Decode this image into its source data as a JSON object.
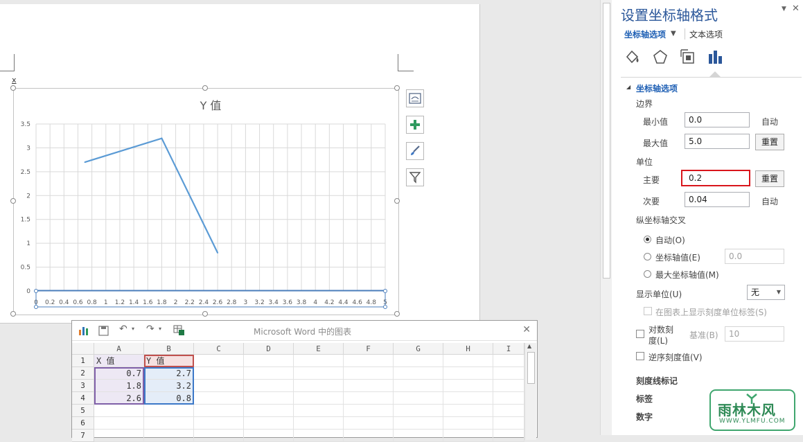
{
  "document": {
    "cursor_mark": "x"
  },
  "chart": {
    "side_buttons": [
      "chart-layout-icon",
      "plus-icon",
      "brush-icon",
      "filter-icon"
    ]
  },
  "chart_data": {
    "type": "scatter",
    "title": "Y 值",
    "mode": "line",
    "x": [
      0.7,
      1.8,
      2.6
    ],
    "y": [
      2.7,
      3.2,
      0.8
    ],
    "xlim": [
      0,
      5
    ],
    "ylim": [
      0,
      3.5
    ],
    "x_ticks": [
      "0",
      "0.2",
      "0.4",
      "0.6",
      "0.8",
      "1",
      "1.2",
      "1.4",
      "1.6",
      "1.8",
      "2",
      "2.2",
      "2.4",
      "2.6",
      "2.8",
      "3",
      "3.2",
      "3.4",
      "3.6",
      "3.8",
      "4",
      "4.2",
      "4.4",
      "4.6",
      "4.8",
      "5"
    ],
    "y_ticks": [
      "0",
      "0.5",
      "1",
      "1.5",
      "2",
      "2.5",
      "3",
      "3.5"
    ],
    "grid": true,
    "line_color": "#5b9bd5"
  },
  "sheet": {
    "title": "Microsoft Word 中的图表",
    "close": "✕",
    "columns": [
      "A",
      "B",
      "C",
      "D",
      "E",
      "F",
      "G",
      "H",
      "I"
    ],
    "rows": [
      "1",
      "2",
      "3",
      "4",
      "5",
      "6",
      "7"
    ],
    "cells": [
      [
        "X 值",
        "Y 值"
      ],
      [
        "0.7",
        "2.7"
      ],
      [
        "1.8",
        "3.2"
      ],
      [
        "2.6",
        "0.8"
      ]
    ],
    "range_colors": {
      "x": "#7f5fa8",
      "y": "#3b78c8",
      "header": "#c0504d"
    }
  },
  "panel": {
    "title": "设置坐标轴格式",
    "header_icons": [
      "▼",
      "✕"
    ],
    "tab_axis": "坐标轴选项",
    "tab_text": "文本选项",
    "section": "坐标轴选项",
    "bounds": "边界",
    "min_label": "最小值",
    "min_value": "0.0",
    "min_auto": "自动",
    "max_label": "最大值",
    "max_value": "5.0",
    "max_reset": "重置",
    "units": "单位",
    "major_label": "主要",
    "major_value": "0.2",
    "major_reset": "重置",
    "minor_label": "次要",
    "minor_value": "0.04",
    "minor_auto": "自动",
    "cross": "纵坐标轴交叉",
    "cross_auto": "自动(O)",
    "cross_value": "坐标轴值(E)",
    "cross_value_input": "0.0",
    "cross_max": "最大坐标轴值(M)",
    "display_units": "显示单位(U)",
    "display_units_value": "无",
    "show_units_label": "在图表上显示刻度单位标签(S)",
    "log_scale_line1": "对数刻",
    "log_scale_line2": "度(L)",
    "base_label": "基准(B)",
    "base_value": "10",
    "reverse": "逆序刻度值(V)",
    "tick_marks": "刻度线标记",
    "labels": "标签",
    "number": "数字",
    "accent_color": "#1e5fb4",
    "highlight_color": "#d9151b"
  },
  "watermark": {
    "name": "雨林木风",
    "url": "WWW.YLMFU.COM"
  }
}
